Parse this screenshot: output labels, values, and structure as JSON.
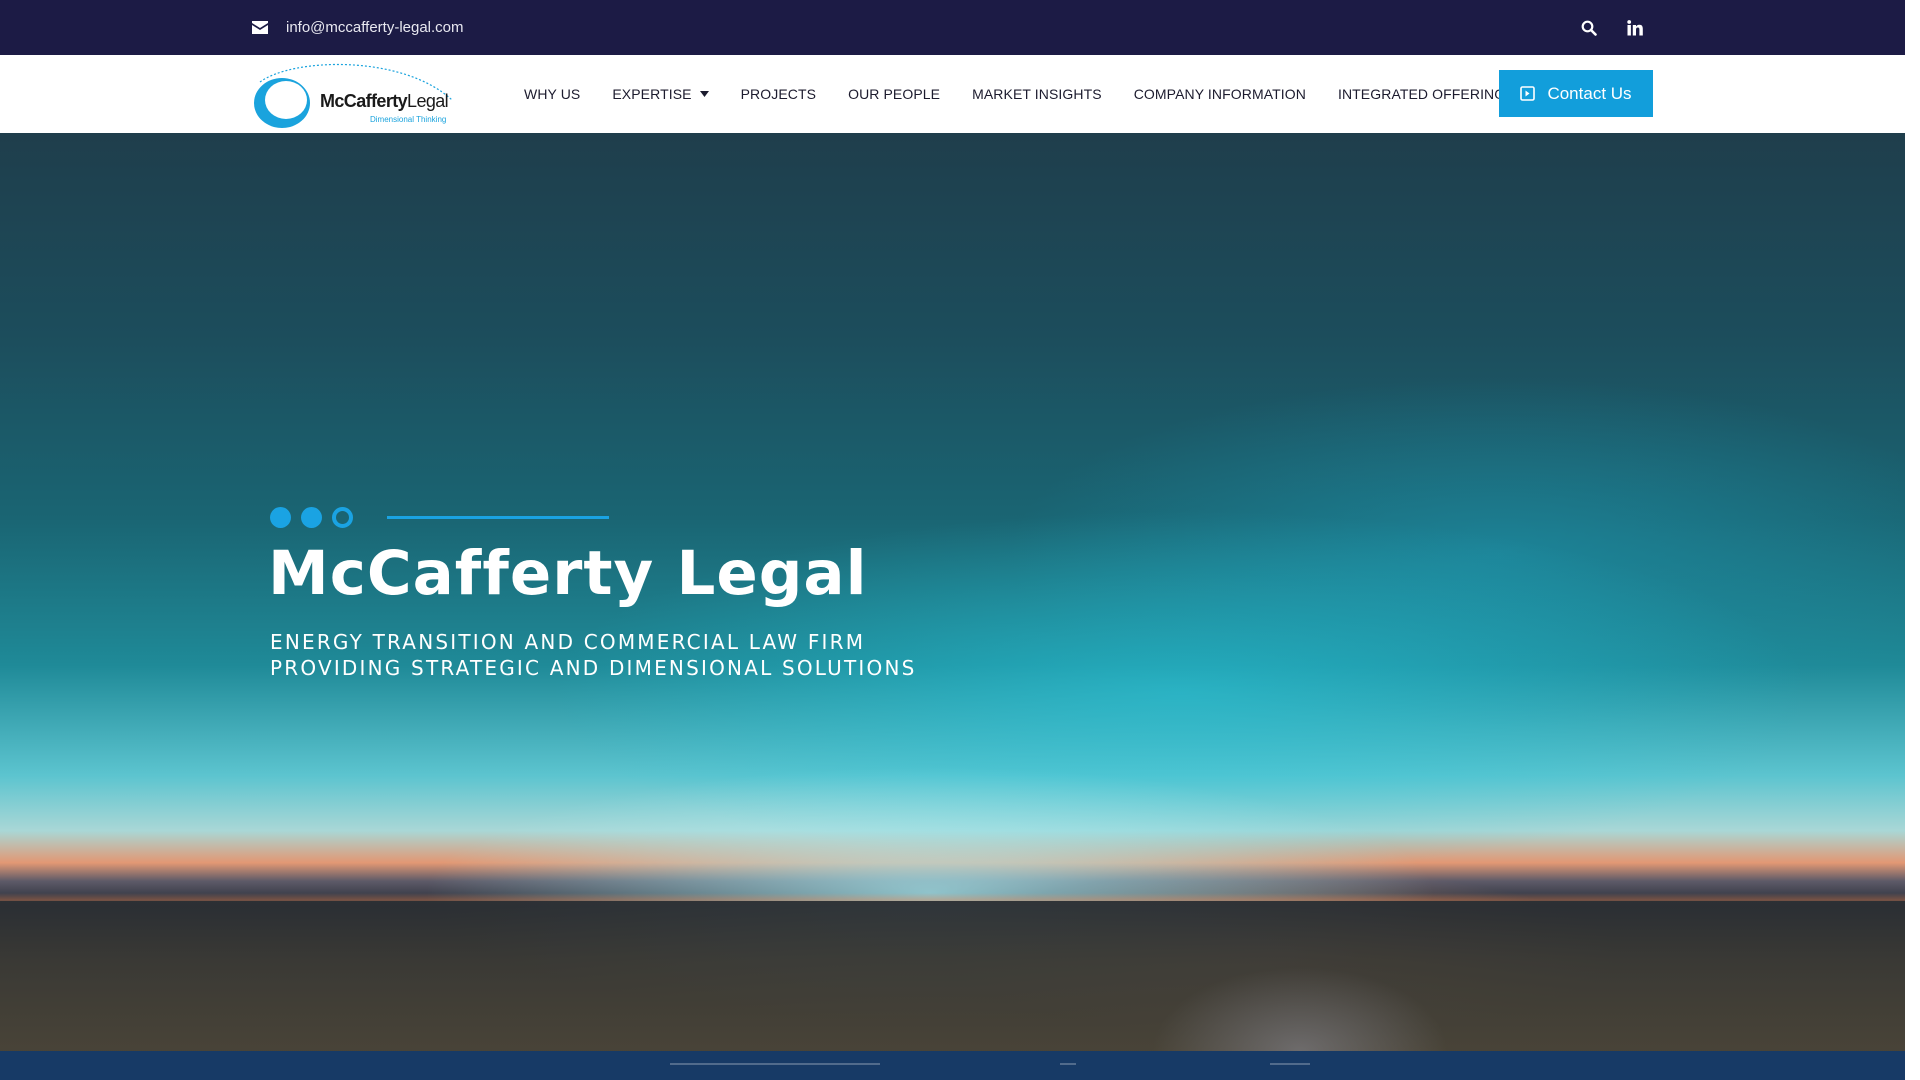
{
  "topbar": {
    "email": "info@mccafferty-legal.com",
    "icons": [
      "envelope-icon",
      "search-icon",
      "linkedin-icon"
    ]
  },
  "header": {
    "logo": {
      "brand_bold": "McCafferty",
      "brand_light": "Legal",
      "tagline": "Dimensional Thinking"
    },
    "nav": [
      {
        "label": "WHY US"
      },
      {
        "label": "EXPERTISE",
        "has_dropdown": true
      },
      {
        "label": "PROJECTS"
      },
      {
        "label": "OUR PEOPLE"
      },
      {
        "label": "MARKET INSIGHTS"
      },
      {
        "label": "COMPANY INFORMATION"
      },
      {
        "label": "INTEGRATED OFFERING"
      }
    ],
    "contact_button": "Contact Us"
  },
  "hero": {
    "title_bold": "McCafferty",
    "title_light": "Legal",
    "subtitle": "ENERGY TRANSITION AND COMMERCIAL LAW FIRM PROVIDING STRATEGIC AND DIMENSIONAL SOLUTIONS"
  },
  "colors": {
    "topbar_bg": "#1c1b45",
    "accent": "#129edb",
    "bottom_band": "#173a66"
  }
}
